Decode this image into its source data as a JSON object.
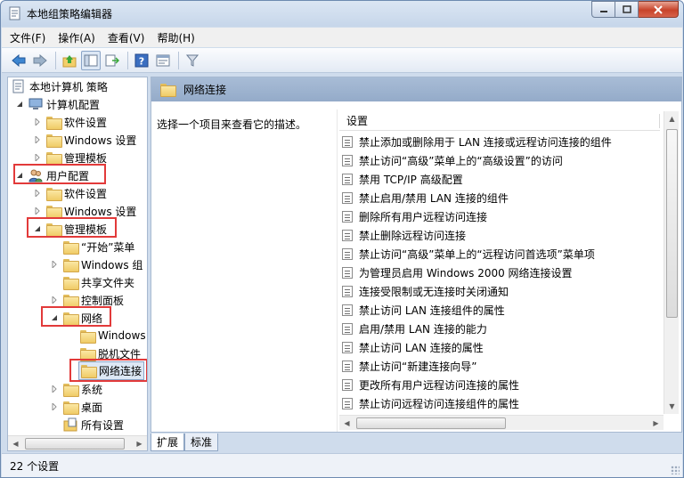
{
  "window": {
    "title": "本地组策略编辑器"
  },
  "menu": {
    "items": [
      "文件(F)",
      "操作(A)",
      "查看(V)",
      "帮助(H)"
    ]
  },
  "toolbar": {
    "icons": [
      "back-arrow-icon",
      "forward-arrow-icon",
      "up-folder-icon",
      "show-hide-tree-icon",
      "export-list-icon",
      "help-icon",
      "properties-icon",
      "filter-icon"
    ]
  },
  "tree": {
    "items": [
      {
        "label": "本地计算机 策略"
      },
      {
        "label": "计算机配置"
      },
      {
        "label": "软件设置"
      },
      {
        "label": "Windows 设置"
      },
      {
        "label": "管理模板"
      },
      {
        "label": "用户配置"
      },
      {
        "label": "软件设置"
      },
      {
        "label": "Windows 设置"
      },
      {
        "label": "管理模板"
      },
      {
        "label": "“开始”菜单"
      },
      {
        "label": "Windows 组"
      },
      {
        "label": "共享文件夹"
      },
      {
        "label": "控制面板"
      },
      {
        "label": "网络"
      },
      {
        "label": "Windows"
      },
      {
        "label": "脱机文件"
      },
      {
        "label": "网络连接"
      },
      {
        "label": "系统"
      },
      {
        "label": "桌面"
      },
      {
        "label": "所有设置"
      }
    ]
  },
  "right": {
    "header_title": "网络连接",
    "description": "选择一个项目来查看它的描述。",
    "column_header": "设置",
    "items": [
      "禁止添加或删除用于 LAN 连接或远程访问连接的组件",
      "禁止访问“高级”菜单上的“高级设置”的访问",
      "禁用 TCP/IP 高级配置",
      "禁止启用/禁用 LAN 连接的组件",
      "删除所有用户远程访问连接",
      "禁止删除远程访问连接",
      "禁止访问“高级”菜单上的“远程访问首选项”菜单项",
      "为管理员启用 Windows 2000 网络连接设置",
      "连接受限制或无连接时关闭通知",
      "禁止访问 LAN 连接组件的属性",
      "启用/禁用 LAN 连接的能力",
      "禁止访问 LAN 连接的属性",
      "禁止访问“新建连接向导”",
      "更改所有用户远程访问连接的属性",
      "禁止访问远程访问连接组件的属性"
    ]
  },
  "tabs": [
    "扩展",
    "标准"
  ],
  "status": {
    "text": "22 个设置"
  },
  "colors": {
    "highlight_box": "#e23a3a",
    "header_band": "#9fb5d1"
  }
}
